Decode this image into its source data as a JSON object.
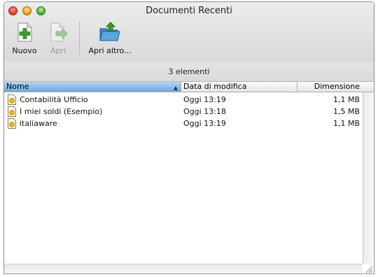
{
  "window": {
    "title": "Documenti Recenti"
  },
  "toolbar": {
    "items": [
      {
        "label": "Nuovo",
        "icon": "new-document-icon",
        "enabled": true
      },
      {
        "label": "Apri",
        "icon": "open-arrow-icon",
        "enabled": false
      },
      {
        "label": "Apri altro...",
        "icon": "folder-open-icon",
        "enabled": true
      }
    ]
  },
  "status": {
    "count_text": "3 elementi"
  },
  "table": {
    "columns": [
      "Nome",
      "Data di modifica",
      "Dimensione"
    ],
    "sort_column": "Nome",
    "rows": [
      {
        "name": "Contabilità Ufficio",
        "modified": "Oggi 13:19",
        "size": "1,1 MB"
      },
      {
        "name": "I miei soldi (Esempio)",
        "modified": "Oggi 13:18",
        "size": "1,5 MB"
      },
      {
        "name": "italiaware",
        "modified": "Oggi 13:19",
        "size": "1,1 MB"
      }
    ]
  },
  "colors": {
    "sort_header": "#6ea6e0",
    "accent_green": "#3c9b2a",
    "folder_blue": "#5aa6dc"
  }
}
